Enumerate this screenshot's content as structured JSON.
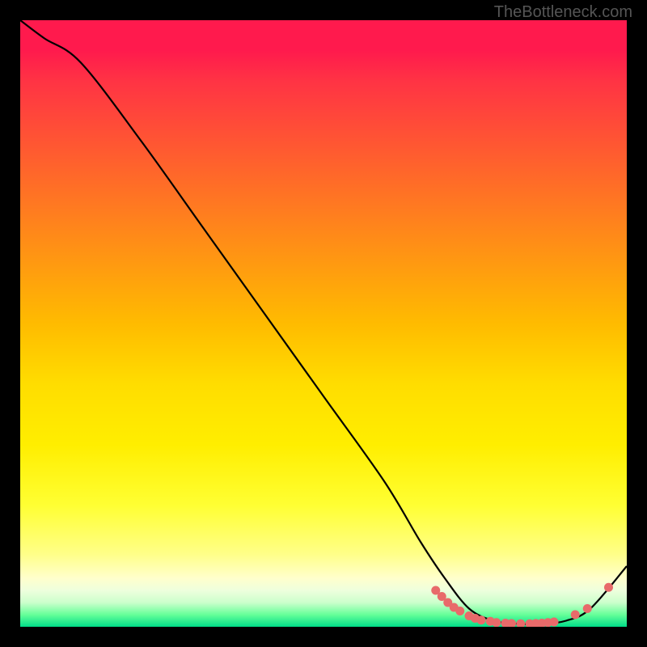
{
  "watermark": "TheBottleneck.com",
  "chart_data": {
    "type": "line",
    "title": "",
    "xlabel": "",
    "ylabel": "",
    "xlim": [
      0,
      100
    ],
    "ylim": [
      0,
      100
    ],
    "grid": false,
    "series": [
      {
        "name": "curve",
        "x": [
          0,
          4,
          10,
          20,
          30,
          40,
          50,
          60,
          66,
          70,
          74,
          78,
          82,
          86,
          90,
          94,
          100
        ],
        "values": [
          100,
          97,
          93,
          80,
          66,
          52,
          38,
          24,
          14,
          8,
          3,
          1,
          0.5,
          0.5,
          1,
          3,
          10
        ]
      }
    ],
    "annotations": {
      "dots_cluster": [
        {
          "x": 68.5,
          "y": 6
        },
        {
          "x": 69.5,
          "y": 5
        },
        {
          "x": 70.5,
          "y": 4
        },
        {
          "x": 71.5,
          "y": 3.2
        },
        {
          "x": 72.5,
          "y": 2.6
        },
        {
          "x": 74,
          "y": 1.8
        },
        {
          "x": 75,
          "y": 1.4
        },
        {
          "x": 76,
          "y": 1.1
        },
        {
          "x": 77.5,
          "y": 0.9
        },
        {
          "x": 78.5,
          "y": 0.7
        },
        {
          "x": 80,
          "y": 0.6
        },
        {
          "x": 81,
          "y": 0.55
        },
        {
          "x": 82.5,
          "y": 0.5
        },
        {
          "x": 84,
          "y": 0.5
        },
        {
          "x": 85,
          "y": 0.55
        },
        {
          "x": 86,
          "y": 0.6
        },
        {
          "x": 87,
          "y": 0.7
        },
        {
          "x": 88,
          "y": 0.8
        },
        {
          "x": 91.5,
          "y": 2
        },
        {
          "x": 93.5,
          "y": 3
        },
        {
          "x": 97,
          "y": 6.5
        }
      ]
    },
    "background_gradient": {
      "direction": "vertical",
      "stops": [
        {
          "pos": 0,
          "color": "#ff1a4d"
        },
        {
          "pos": 50,
          "color": "#ffbb00"
        },
        {
          "pos": 80,
          "color": "#ffff33"
        },
        {
          "pos": 95,
          "color": "#eeffdd"
        },
        {
          "pos": 100,
          "color": "#00dd88"
        }
      ]
    }
  }
}
